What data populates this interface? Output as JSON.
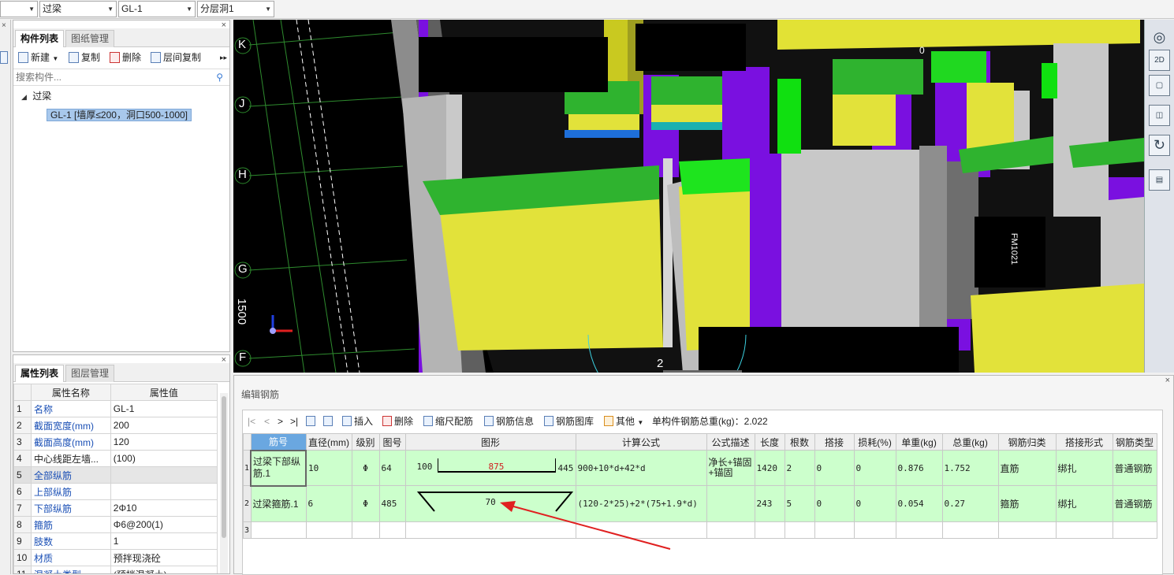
{
  "topbar": {
    "combo_first": "",
    "combo_type": "过梁",
    "combo_component": "GL-1",
    "combo_layer": "分层洞1"
  },
  "component_panel": {
    "tab_active": "构件列表",
    "tab_other": "图纸管理",
    "tools": {
      "new": "新建",
      "copy": "复制",
      "delete": "删除",
      "floor_copy": "层间复制"
    },
    "search_placeholder": "搜索构件...",
    "tree": {
      "group": "过梁",
      "item": "GL-1 [墙厚≤200，洞口500-1000]"
    }
  },
  "property_panel": {
    "tab_active": "属性列表",
    "tab_other": "图层管理",
    "header_name": "属性名称",
    "header_value": "属性值",
    "rows": [
      {
        "no": "1",
        "name": "名称",
        "value": "GL-1"
      },
      {
        "no": "2",
        "name": "截面宽度(mm)",
        "value": "200"
      },
      {
        "no": "3",
        "name": "截面高度(mm)",
        "value": "120"
      },
      {
        "no": "4",
        "name": "中心线距左墙...",
        "value": "(100)"
      },
      {
        "no": "5",
        "name": "全部纵筋",
        "value": ""
      },
      {
        "no": "6",
        "name": "上部纵筋",
        "value": ""
      },
      {
        "no": "7",
        "name": "下部纵筋",
        "value": "2Φ10"
      },
      {
        "no": "8",
        "name": "箍筋",
        "value": "Φ6@200(1)"
      },
      {
        "no": "9",
        "name": "肢数",
        "value": "1"
      },
      {
        "no": "10",
        "name": "材质",
        "value": "预拌现浇砼"
      },
      {
        "no": "11",
        "name": "混凝土类型",
        "value": "(预拌混凝土)"
      }
    ]
  },
  "viewport": {
    "axis_labels": [
      "K",
      "J",
      "H",
      "G",
      "F"
    ],
    "dimension": "1500",
    "door_label": "FM1021",
    "circle_label": "2",
    "top_mark": "0"
  },
  "right_tools": {
    "view2d": "2D"
  },
  "rebar_editor": {
    "title": "编辑钢筋",
    "nav": {
      "first": "|<",
      "prev": "<",
      "next": ">",
      "last": ">|"
    },
    "tools": {
      "insert": "插入",
      "delete": "删除",
      "scale": "缩尺配筋",
      "info": "钢筋信息",
      "library": "钢筋图库",
      "other": "其他",
      "total_label": "单构件钢筋总重(kg)：2.022"
    },
    "columns": [
      "筋号",
      "直径(mm)",
      "级别",
      "图号",
      "图形",
      "计算公式",
      "公式描述",
      "长度",
      "根数",
      "搭接",
      "损耗(%)",
      "单重(kg)",
      "总重(kg)",
      "钢筋归类",
      "搭接形式",
      "钢筋类型"
    ],
    "rows": [
      {
        "ln": "1",
        "name": "过梁下部纵筋.1",
        "diameter": "10",
        "grade": "Φ",
        "figure_no": "64",
        "shape_left": "100",
        "shape_mid": "875",
        "shape_right": "445",
        "formula": "900+10*d+42*d",
        "desc": "净长+锚固+锚固",
        "length": "1420",
        "count": "2",
        "lap": "0",
        "loss": "0",
        "unit_weight": "0.876",
        "total_weight": "1.752",
        "category": "直筋",
        "lap_type": "绑扎",
        "rebar_type": "普通钢筋"
      },
      {
        "ln": "2",
        "name": "过梁箍筋.1",
        "diameter": "6",
        "grade": "Φ",
        "figure_no": "485",
        "shape_mid": "70",
        "formula": "(120-2*25)+2*(75+1.9*d)",
        "desc": "",
        "length": "243",
        "count": "5",
        "lap": "0",
        "loss": "0",
        "unit_weight": "0.054",
        "total_weight": "0.27",
        "category": "箍筋",
        "lap_type": "绑扎",
        "rebar_type": "普通钢筋"
      },
      {
        "ln": "3"
      }
    ]
  }
}
